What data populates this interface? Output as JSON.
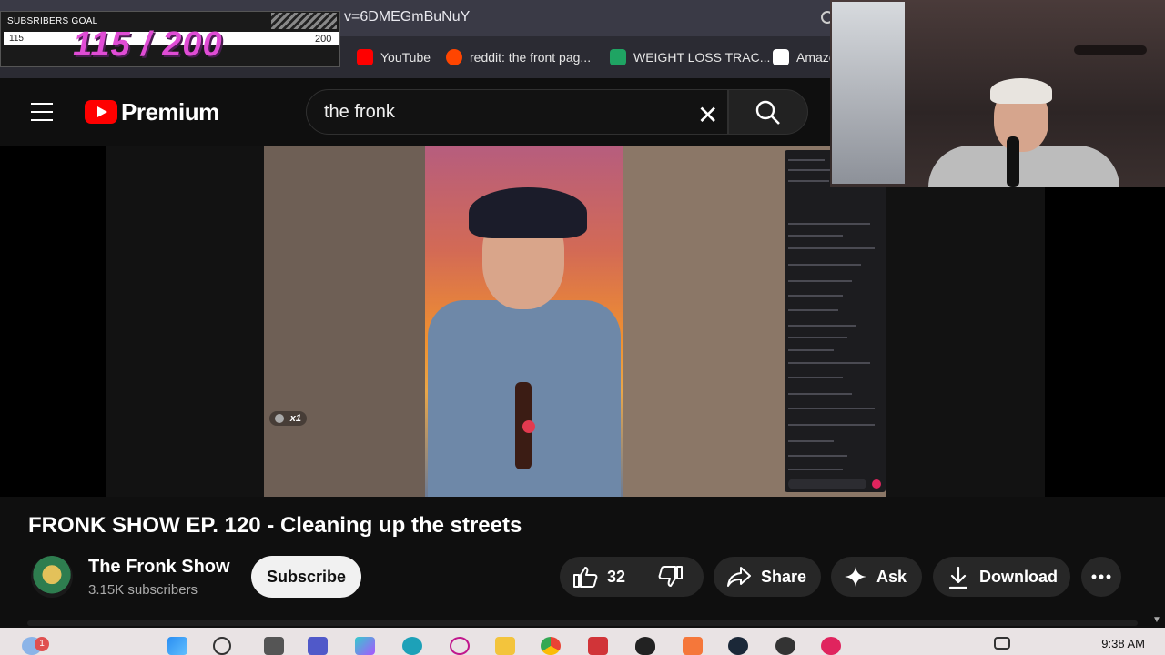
{
  "browser": {
    "url_fragment": "v=6DMEGmBuNuY",
    "bookmarks": [
      {
        "label": "YouTube",
        "icon": "youtube-icon",
        "color": "#ff0000"
      },
      {
        "label": "reddit: the front pag...",
        "icon": "reddit-icon",
        "color": "#ff4500"
      },
      {
        "label": "WEIGHT LOSS TRAC...",
        "icon": "sheets-icon",
        "color": "#1fa463"
      },
      {
        "label": "Amazo",
        "icon": "amazon-icon",
        "color": "#ffffff"
      }
    ]
  },
  "goal_overlay": {
    "title": "SUBSRIBERS GOAL",
    "min": "115",
    "max": "200",
    "progress_text": "115 / 200",
    "progress": 0.575
  },
  "header": {
    "brand": "Premium",
    "search_value": "the fronk"
  },
  "video": {
    "gift_tag": "x1",
    "title": "FRONK SHOW EP. 120 - Cleaning up the streets"
  },
  "channel": {
    "name": "The Fronk Show",
    "subscribers": "3.15K subscribers",
    "subscribe_label": "Subscribe"
  },
  "actions": {
    "like_count": "32",
    "share_label": "Share",
    "ask_label": "Ask",
    "download_label": "Download"
  },
  "taskbar": {
    "notification_count": "1",
    "clock": "9:38 AM"
  },
  "colors": {
    "accent": "#ff0000",
    "goal_pink": "#e04cd5"
  }
}
